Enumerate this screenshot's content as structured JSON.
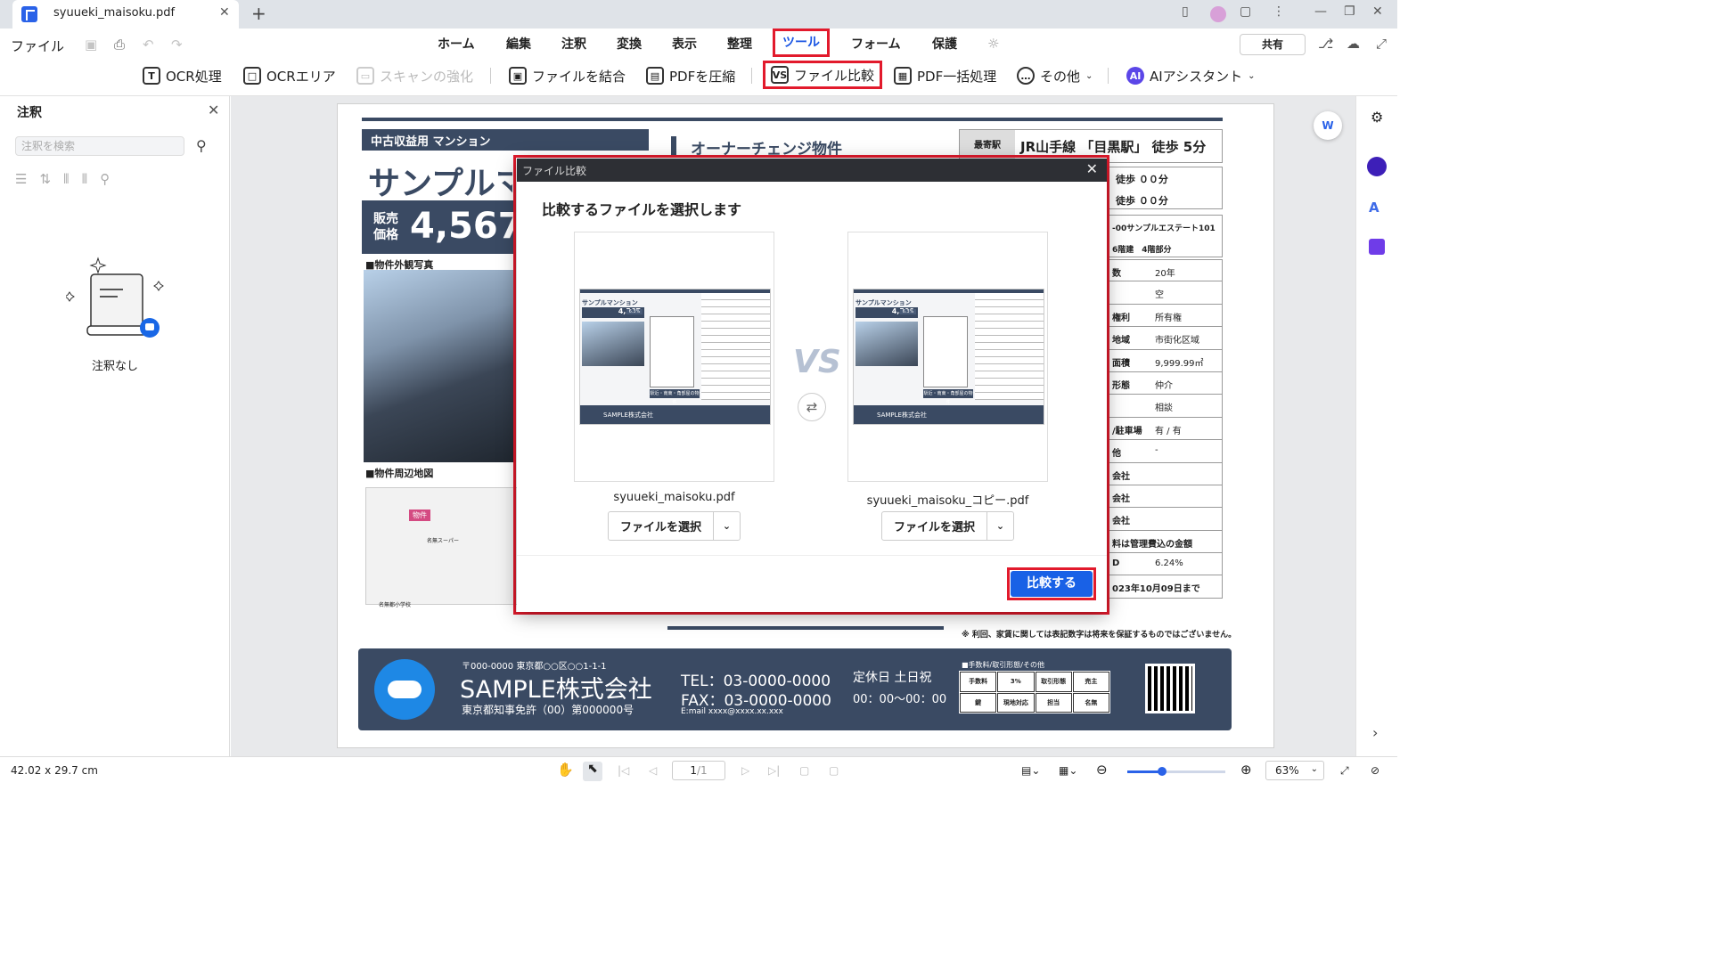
{
  "titlebar": {
    "tab_title": "syuueki_maisoku.pdf",
    "close": "✕",
    "add": "+"
  },
  "menubar": {
    "file": "ファイル",
    "menus": [
      "ホーム",
      "編集",
      "注釈",
      "変換",
      "表示",
      "整理",
      "ツール",
      "フォーム",
      "保護"
    ],
    "share": "共有"
  },
  "toolbar": {
    "items": [
      {
        "label": "OCR処理",
        "icon": "T"
      },
      {
        "label": "OCRエリア",
        "icon": "□"
      },
      {
        "label": "スキャンの強化",
        "icon": "▭"
      },
      {
        "label": "ファイルを結合",
        "icon": "▣"
      },
      {
        "label": "PDFを圧縮",
        "icon": "▤"
      },
      {
        "label": "ファイル比較",
        "icon": "VS"
      },
      {
        "label": "PDF一括処理",
        "icon": "▦"
      },
      {
        "label": "その他",
        "icon": "…"
      },
      {
        "label": "AIアシスタント",
        "icon": "AI"
      }
    ]
  },
  "sidebar": {
    "title": "注釈",
    "search_placeholder": "注釈を検索",
    "empty": "注釈なし"
  },
  "document": {
    "type_label": "中古収益用 マンション",
    "heading": "オーナーチェンジ物件",
    "title": "サンプルマンション",
    "price_label": "販売価格",
    "price": "4,567",
    "photo_label": "■物件外観写真",
    "map_label": "■物件周辺地図",
    "map_pin": "物件",
    "map_store": "名無スーパー",
    "map_school": "名無都小学校",
    "station_label": "最寄駅",
    "station": "JR山手線 「目黒駅」 徒歩 5分",
    "walk1": "徒歩 ００分",
    "walk2": "徒歩 ００分",
    "addr": "-00サンプルエステート101",
    "bld": "6階建　4階部分",
    "rows": [
      {
        "k": "数",
        "v": "20年"
      },
      {
        "k": "",
        "v": "空"
      },
      {
        "k": "権利",
        "v": "所有権"
      },
      {
        "k": "地域",
        "v": "市街化区域"
      },
      {
        "k": "面積",
        "v": "9,999.99㎡"
      },
      {
        "k": "形態",
        "v": "仲介"
      },
      {
        "k": "",
        "v": "相談"
      },
      {
        "k": "/駐車場",
        "v": "有 / 有"
      },
      {
        "k": "他",
        "v": "-"
      },
      {
        "k": "会社",
        "v": ""
      },
      {
        "k": "会社",
        "v": ""
      },
      {
        "k": "会社",
        "v": ""
      },
      {
        "k": "料は管理費込の金額",
        "v": ""
      },
      {
        "k": "D",
        "v": "6.24%"
      },
      {
        "k": "023年10月09日まで",
        "v": ""
      }
    ],
    "note": "※ 利回、家賃に関しては表記数字は将来を保証するものではございません。",
    "footer": {
      "zip": "〒000-0000 東京都○○区○○1-1-1",
      "company": "SAMPLE株式会社",
      "license": "東京都知事免許（00）第000000号",
      "tel": "TEL：03-0000-0000",
      "fax": "FAX：03-0000-0000",
      "email": "E:mail xxxx@xxxx.xx.xxx",
      "holiday": "定休日 土日祝",
      "hours": "00：00～00：00",
      "fee_title": "■手数料/取引形態/その他",
      "fee": [
        "手数料",
        "3%",
        "取引形態",
        "売主",
        "鍵",
        "現地対応",
        "担当",
        "名無"
      ]
    }
  },
  "dialog": {
    "title": "ファイル比較",
    "subtitle": "比較するファイルを選択します",
    "left_file": "syuueki_maisoku.pdf",
    "right_file": "syuueki_maisoku_コピー.pdf",
    "choose": "ファイルを選択",
    "vs": "VS",
    "compare": "比較する",
    "left_thumb": {
      "title": "サンプルマンション",
      "price": "4,567",
      "pct": "6.3%"
    },
    "right_thumb": {
      "title": "サンプルマンション",
      "price": "4,500",
      "pct": "6.3%"
    },
    "thumb_footer": "SAMPLE株式会社",
    "thumb_strip": "駅近・南東・角部屋の物件"
  },
  "status": {
    "size": "42.02 x 29.7 cm",
    "page": "1",
    "pages": "/1",
    "zoom": "63%"
  }
}
